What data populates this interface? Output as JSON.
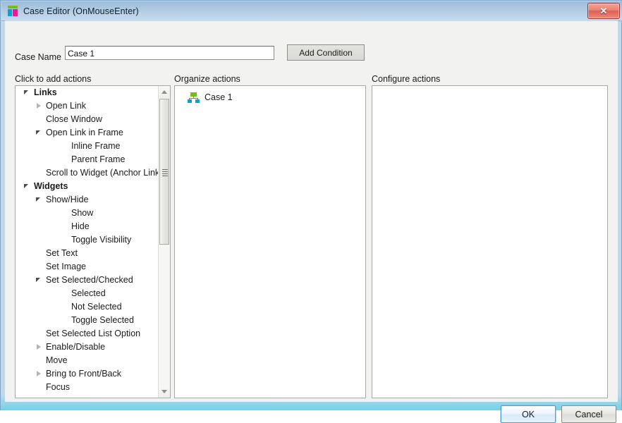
{
  "window": {
    "title": "Case Editor (OnMouseEnter)",
    "icon": "axure-logo-icon",
    "close_label": "✕"
  },
  "form": {
    "case_name_label": "Case Name",
    "case_name_value": "Case 1",
    "case_name_placeholder": "",
    "add_condition_label": "Add Condition"
  },
  "columns": {
    "actions_header": "Click to add actions",
    "organize_header": "Organize actions",
    "configure_header": "Configure actions"
  },
  "action_tree": [
    {
      "label": "Links",
      "level": 0,
      "twisty": "expanded",
      "bold": true
    },
    {
      "label": "Open Link",
      "level": 1,
      "twisty": "collapsed",
      "bold": false
    },
    {
      "label": "Close Window",
      "level": 1,
      "twisty": "none",
      "bold": false
    },
    {
      "label": "Open Link in Frame",
      "level": 1,
      "twisty": "expanded",
      "bold": false
    },
    {
      "label": "Inline Frame",
      "level": 2,
      "twisty": "none",
      "bold": false
    },
    {
      "label": "Parent Frame",
      "level": 2,
      "twisty": "none",
      "bold": false
    },
    {
      "label": "Scroll to Widget (Anchor Link)",
      "level": 1,
      "twisty": "none",
      "bold": false
    },
    {
      "label": "Widgets",
      "level": 0,
      "twisty": "expanded",
      "bold": true
    },
    {
      "label": "Show/Hide",
      "level": 1,
      "twisty": "expanded",
      "bold": false
    },
    {
      "label": "Show",
      "level": 2,
      "twisty": "none",
      "bold": false
    },
    {
      "label": "Hide",
      "level": 2,
      "twisty": "none",
      "bold": false
    },
    {
      "label": "Toggle Visibility",
      "level": 2,
      "twisty": "none",
      "bold": false
    },
    {
      "label": "Set Text",
      "level": 1,
      "twisty": "none",
      "bold": false
    },
    {
      "label": "Set Image",
      "level": 1,
      "twisty": "none",
      "bold": false
    },
    {
      "label": "Set Selected/Checked",
      "level": 1,
      "twisty": "expanded",
      "bold": false
    },
    {
      "label": "Selected",
      "level": 2,
      "twisty": "none",
      "bold": false
    },
    {
      "label": "Not Selected",
      "level": 2,
      "twisty": "none",
      "bold": false
    },
    {
      "label": "Toggle Selected",
      "level": 2,
      "twisty": "none",
      "bold": false
    },
    {
      "label": "Set Selected List Option",
      "level": 1,
      "twisty": "none",
      "bold": false
    },
    {
      "label": "Enable/Disable",
      "level": 1,
      "twisty": "collapsed",
      "bold": false
    },
    {
      "label": "Move",
      "level": 1,
      "twisty": "none",
      "bold": false
    },
    {
      "label": "Bring to Front/Back",
      "level": 1,
      "twisty": "collapsed",
      "bold": false
    },
    {
      "label": "Focus",
      "level": 1,
      "twisty": "none",
      "bold": false
    }
  ],
  "organize": {
    "nodes": [
      {
        "label": "Case 1",
        "icon": "hierarchy-icon"
      }
    ]
  },
  "configure": {
    "content": ""
  },
  "footer": {
    "ok_label": "OK",
    "cancel_label": "Cancel"
  },
  "colors": {
    "titlebar": "#aec8e0",
    "window_border": "#7ea6c8",
    "accent_bottom": "#6fd3e8",
    "close_red": "#de5f52",
    "logo_green": "#76bc21",
    "logo_cyan": "#00a6d6",
    "logo_magenta": "#ec1a8d",
    "node_blue": "#0a9fd8",
    "ok_border_blue": "#4b9ed6",
    "panel_bg": "#f2f2f0"
  }
}
